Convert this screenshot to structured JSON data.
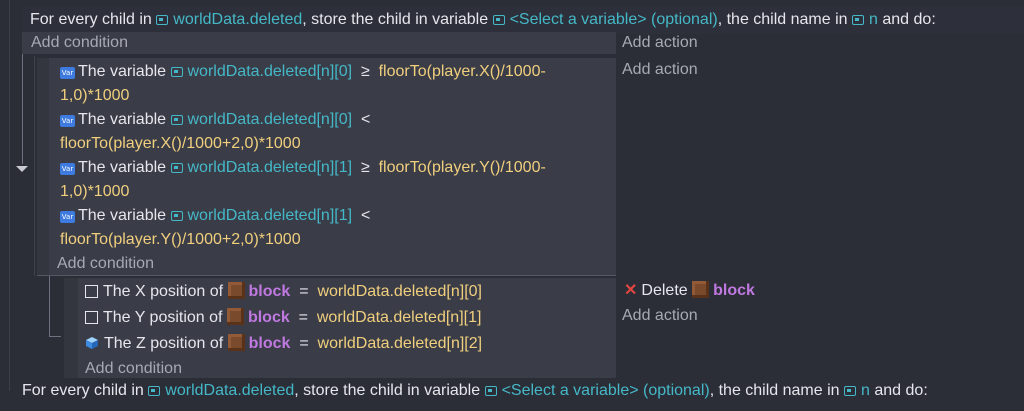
{
  "header": {
    "prefix": "For every child in",
    "collection": "worldData.deleted",
    "mid1": ", store the child in variable",
    "child_var": "<Select a variable> (optional)",
    "mid2": ", the child name in",
    "name_var": "n",
    "suffix": "and do:"
  },
  "outer": {
    "add_condition": "Add condition",
    "add_action": "Add action"
  },
  "group1": {
    "add_action": "Add action",
    "add_condition": "Add condition",
    "conditions": [
      {
        "label": "The variable",
        "var": "worldData.deleted[n][0]",
        "op": "≥",
        "expr1": "floorTo(player.X()/1000-",
        "expr2": "1,0)*1000"
      },
      {
        "label": "The variable",
        "var": "worldData.deleted[n][0]",
        "op": "<",
        "expr1": "",
        "expr2": "floorTo(player.X()/1000+2,0)*1000"
      },
      {
        "label": "The variable",
        "var": "worldData.deleted[n][1]",
        "op": "≥",
        "expr1": "floorTo(player.Y()/1000-",
        "expr2": "1,0)*1000"
      },
      {
        "label": "The variable",
        "var": "worldData.deleted[n][1]",
        "op": "<",
        "expr1": "",
        "expr2": "floorTo(player.Y()/1000+2,0)*1000"
      }
    ],
    "var_tag": "Var"
  },
  "group2": {
    "conditions": [
      {
        "label": "The X position of",
        "object": "block",
        "op": "=",
        "value": "worldData.deleted[n][0]"
      },
      {
        "label": "The Y position of",
        "object": "block",
        "op": "=",
        "value": "worldData.deleted[n][1]"
      },
      {
        "label": "The Z position of",
        "object": "block",
        "op": "=",
        "value": "worldData.deleted[n][2]"
      }
    ],
    "add_condition": "Add condition",
    "action": {
      "label": "Delete",
      "object": "block"
    },
    "add_action": "Add action"
  },
  "footer": {
    "fragments": [
      "For every child in",
      "worldData.deleted",
      ", store the child in variable",
      "<Select a variable> (optional)",
      ", the child name in",
      "n",
      "and do:"
    ]
  },
  "colors": {
    "variable": "#45b8c7",
    "expression": "#f0cf7d",
    "object": "#c079e0",
    "delete": "#e0453f"
  }
}
